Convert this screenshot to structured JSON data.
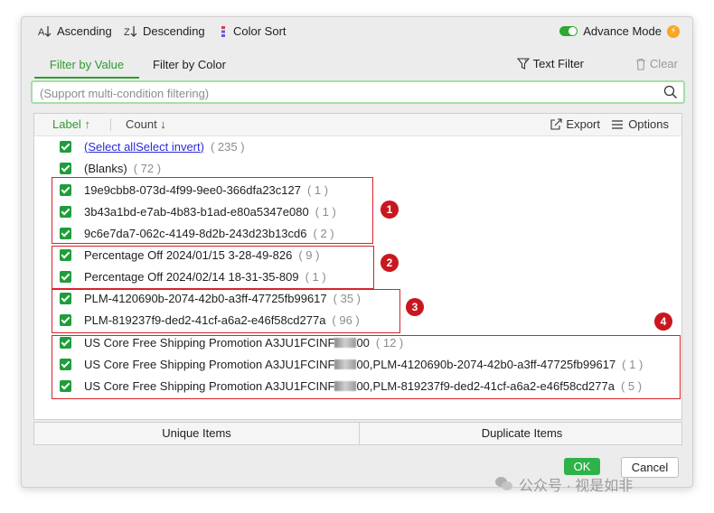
{
  "toolbar": {
    "ascending": "Ascending",
    "descending": "Descending",
    "color_sort": "Color Sort",
    "advance_mode": "Advance Mode"
  },
  "tabs": {
    "filter_by_value": "Filter by Value",
    "filter_by_color": "Filter by Color",
    "text_filter": "Text Filter",
    "clear": "Clear"
  },
  "search": {
    "placeholder": "(Support multi-condition filtering)"
  },
  "list_header": {
    "label": "Label",
    "count": "Count",
    "export": "Export",
    "options": "Options"
  },
  "rows": [
    {
      "select_all": "(Select all",
      "select_invert": "Select invert)",
      "count": "( 235 )"
    },
    {
      "label": "(Blanks)",
      "count": "( 72 )"
    },
    {
      "label": "19e9cbb8-073d-4f99-9ee0-366dfa23c127",
      "count": "( 1 )"
    },
    {
      "label": "3b43a1bd-e7ab-4b83-b1ad-e80a5347e080",
      "count": "( 1 )"
    },
    {
      "label": "9c6e7da7-062c-4149-8d2b-243d23b13cd6",
      "count": "( 2 )"
    },
    {
      "label": "Percentage Off 2024/01/15 3-28-49-826",
      "count": "( 9 )"
    },
    {
      "label": "Percentage Off 2024/02/14 18-31-35-809",
      "count": "( 1 )"
    },
    {
      "label": "PLM-4120690b-2074-42b0-a3ff-47725fb99617",
      "count": "( 35 )"
    },
    {
      "label": "PLM-819237f9-ded2-41cf-a6a2-e46f58cd277a",
      "count": "( 96 )"
    },
    {
      "label_a": "US Core Free Shipping Promotion A3JU1FCINF",
      "label_b": "00",
      "count": "( 12 )"
    },
    {
      "label_a": "US Core Free Shipping Promotion A3JU1FCINF",
      "label_b": "00,PLM-4120690b-2074-42b0-a3ff-47725fb99617",
      "count": "( 1 )"
    },
    {
      "label_a": "US Core Free Shipping Promotion A3JU1FCINF",
      "label_b": "00,PLM-819237f9-ded2-41cf-a6a2-e46f58cd277a",
      "count": "( 5 )"
    }
  ],
  "annotations": [
    "1",
    "2",
    "3",
    "4"
  ],
  "bottom_tabs": {
    "unique": "Unique Items",
    "duplicate": "Duplicate Items"
  },
  "buttons": {
    "ok": "OK",
    "cancel": "Cancel"
  },
  "watermark": "公众号 · 视是如非",
  "colors": {
    "accent": "#2e9b2e",
    "checkbox": "#1f9d3a",
    "annotation": "#d8242a"
  }
}
